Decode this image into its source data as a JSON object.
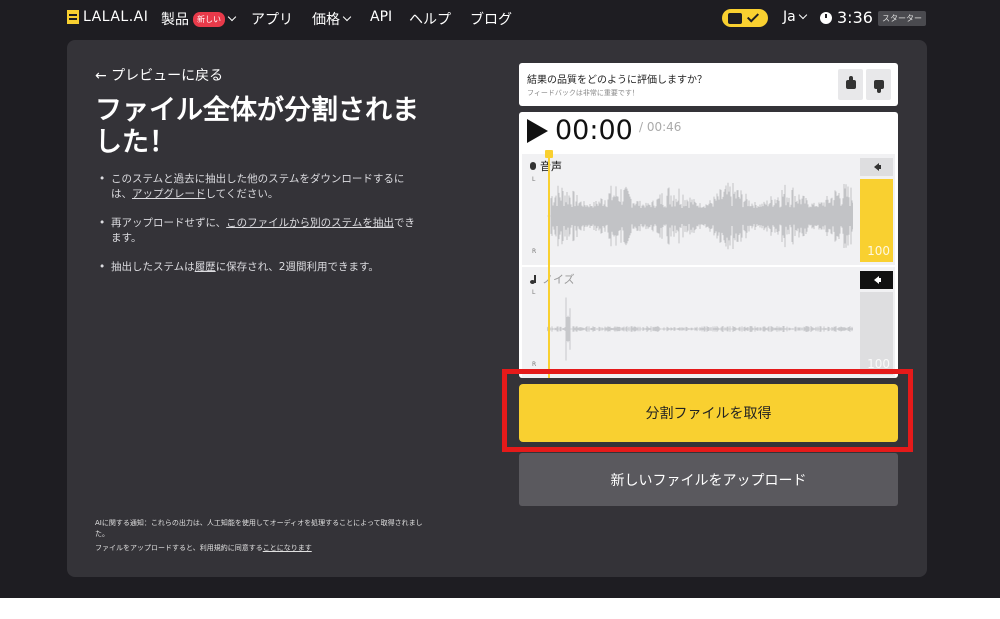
{
  "nav": {
    "logo": "LALAL.AI",
    "products": "製品",
    "new_badge": "新しい",
    "apps": "アプリ",
    "pricing": "価格",
    "api": "API",
    "help": "ヘルプ",
    "blog": "ブログ",
    "language": "Ja",
    "time": "3:36",
    "plan": "スターター"
  },
  "main": {
    "back": "← プレビューに戻る",
    "title": "ファイル全体が分割されました！",
    "bullets": [
      {
        "pre": "このステムと過去に抽出した他のステムをダウンロードするには、",
        "link": "アップグレード",
        "post": "してください。"
      },
      {
        "pre": "再アップロードせずに、",
        "link": "このファイルから別のステムを抽出",
        "post": "できます。"
      },
      {
        "pre": "抽出したステムは",
        "link": "履歴",
        "post": "に保存され、2週間利用できます。"
      }
    ],
    "ai_notice": "AIに関する通知：これらの出力は、人工知能を使用してオーディオを処理することによって取得されました。",
    "terms_pre": "ファイルをアップロードすると、利用規約に同意する",
    "terms_link": "ことになります"
  },
  "rating": {
    "question": "結果の品質をどのように評価しますか？",
    "subtitle": "フィードバックは非常に重要です！"
  },
  "player": {
    "current_time": "00:00",
    "total_time": "/ 00:46",
    "tracks": [
      {
        "name": "音声",
        "volume": "100",
        "volume_level": 1.0,
        "muted": false
      },
      {
        "name": "ノイズ",
        "volume": "100",
        "volume_level": 1.0,
        "muted": true
      }
    ],
    "channel_left": "L",
    "channel_right": "R"
  },
  "buttons": {
    "get_stems": "分割ファイルを取得",
    "upload_new": "新しいファイルをアップロード"
  },
  "colors": {
    "accent": "#f9d030",
    "highlight": "#e51a1a"
  }
}
